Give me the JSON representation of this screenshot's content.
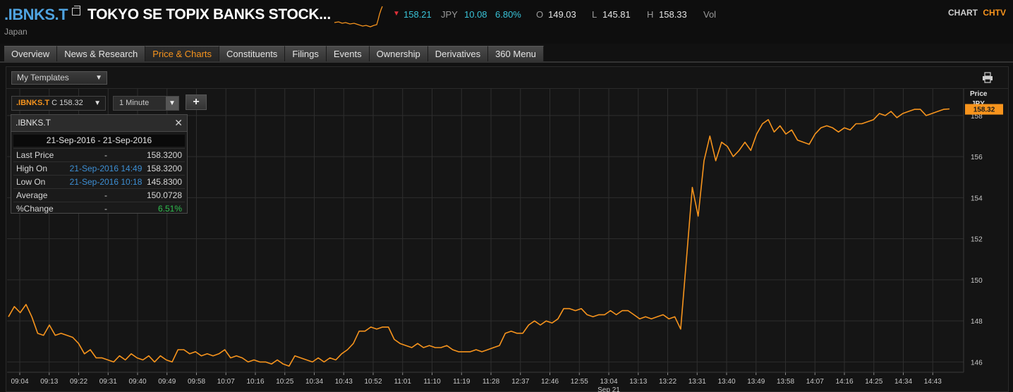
{
  "header": {
    "ric": ".IBNKS.T",
    "name": "TOKYO SE TOPIX BANKS STOCK...",
    "country": "Japan",
    "last": "158.21",
    "currency": "JPY",
    "change": "10.08",
    "pct_change": "6.80%",
    "open_label": "O",
    "open": "149.03",
    "low_label": "L",
    "low": "145.81",
    "high_label": "H",
    "high": "158.33",
    "vol_label": "Vol",
    "chart_label": "CHART",
    "app_label": "CHTV"
  },
  "tabs": [
    {
      "label": "Overview",
      "active": false
    },
    {
      "label": "News & Research",
      "active": false
    },
    {
      "label": "Price & Charts",
      "active": true
    },
    {
      "label": "Constituents",
      "active": false
    },
    {
      "label": "Filings",
      "active": false
    },
    {
      "label": "Events",
      "active": false
    },
    {
      "label": "Ownership",
      "active": false
    },
    {
      "label": "Derivatives",
      "active": false
    },
    {
      "label": "360 Menu",
      "active": false
    }
  ],
  "toolbar": {
    "templates": "My Templates",
    "ric_selector": ".IBNKS.T",
    "ric_close": "C 158.32",
    "interval": "1 Minute",
    "add": "+"
  },
  "tooltip": {
    "title": ".IBNKS.T",
    "range": "21-Sep-2016 - 21-Sep-2016",
    "rows": [
      {
        "label": "Last Price",
        "when": "-",
        "value": "158.3200"
      },
      {
        "label": "High On",
        "when": "21-Sep-2016 14:49",
        "value": "158.3200"
      },
      {
        "label": "Low On",
        "when": "21-Sep-2016 10:18",
        "value": "145.8300"
      },
      {
        "label": "Average",
        "when": "-",
        "value": "150.0728"
      },
      {
        "label": "%Change",
        "when": "-",
        "value": "6.51%"
      }
    ]
  },
  "colors": {
    "accent": "#f7941d",
    "ric_blue": "#4fa3e0",
    "change_cyan": "#39c3d8",
    "down_red": "#e0303a",
    "positive_green": "#2fbf4f",
    "line": "#f7941d",
    "grid": "#2e2e2e"
  },
  "chart_data": {
    "type": "line",
    "ylabel": "Price",
    "yunit": "JPY",
    "last_value_label": "158.32",
    "date_label": "Sep 21",
    "ylim": [
      145.5,
      159.3
    ],
    "yticks": [
      146,
      148,
      150,
      152,
      154,
      156,
      158
    ],
    "xticks": [
      "09:04",
      "09:13",
      "09:22",
      "09:31",
      "09:40",
      "09:49",
      "09:58",
      "10:07",
      "10:16",
      "10:25",
      "10:34",
      "10:43",
      "10:52",
      "11:01",
      "11:10",
      "11:19",
      "11:28",
      "12:37",
      "12:46",
      "12:55",
      "13:04",
      "13:13",
      "13:22",
      "13:31",
      "13:40",
      "13:49",
      "13:58",
      "14:07",
      "14:16",
      "14:25",
      "14:34",
      "14:43"
    ],
    "grid": true,
    "series": [
      {
        "values": [
          148.2,
          148.7,
          148.4,
          148.8,
          148.2,
          147.4,
          147.3,
          147.8,
          147.3,
          147.4,
          147.3,
          147.2,
          146.9,
          146.4,
          146.6,
          146.2,
          146.2,
          146.1,
          146.0,
          146.3,
          146.1,
          146.4,
          146.2,
          146.1,
          146.3,
          146.0,
          146.3,
          146.1,
          146.0,
          146.6,
          146.6,
          146.4,
          146.5,
          146.3,
          146.4,
          146.3,
          146.4,
          146.6,
          146.2,
          146.3,
          146.2,
          146.0,
          146.1,
          146.0,
          146.0,
          145.9,
          146.1,
          145.9,
          145.8,
          146.3,
          146.2,
          146.1,
          146.0,
          146.2,
          146.0,
          146.2,
          146.1,
          146.4,
          146.6,
          146.9,
          147.5,
          147.5,
          147.7,
          147.6,
          147.7,
          147.7,
          147.1,
          146.9,
          146.8,
          146.7,
          146.9,
          146.7,
          146.8,
          146.7,
          146.7,
          146.8,
          146.6,
          146.5,
          146.5,
          146.5,
          146.6,
          146.5,
          146.6,
          146.7,
          146.8,
          147.4,
          147.5,
          147.4,
          147.4,
          147.8,
          148.0,
          147.8,
          148.0,
          147.9,
          148.1,
          148.6,
          148.6,
          148.5,
          148.6,
          148.3,
          148.2,
          148.3,
          148.3,
          148.5,
          148.3,
          148.5,
          148.5,
          148.3,
          148.1,
          148.2,
          148.1,
          148.2,
          148.3,
          148.1,
          148.2,
          147.6,
          151.0,
          154.5,
          153.1,
          155.8,
          157.0,
          155.8,
          156.7,
          156.5,
          156.0,
          156.3,
          156.7,
          156.3,
          157.1,
          157.6,
          157.8,
          157.2,
          157.5,
          157.1,
          157.3,
          156.8,
          156.7,
          156.6,
          157.1,
          157.4,
          157.5,
          157.4,
          157.2,
          157.4,
          157.3,
          157.6,
          157.6,
          157.7,
          157.8,
          158.1,
          158.0,
          158.2,
          157.9,
          158.1,
          158.2,
          158.3,
          158.3,
          158.0,
          158.1,
          158.2,
          158.3,
          158.32
        ]
      }
    ]
  }
}
